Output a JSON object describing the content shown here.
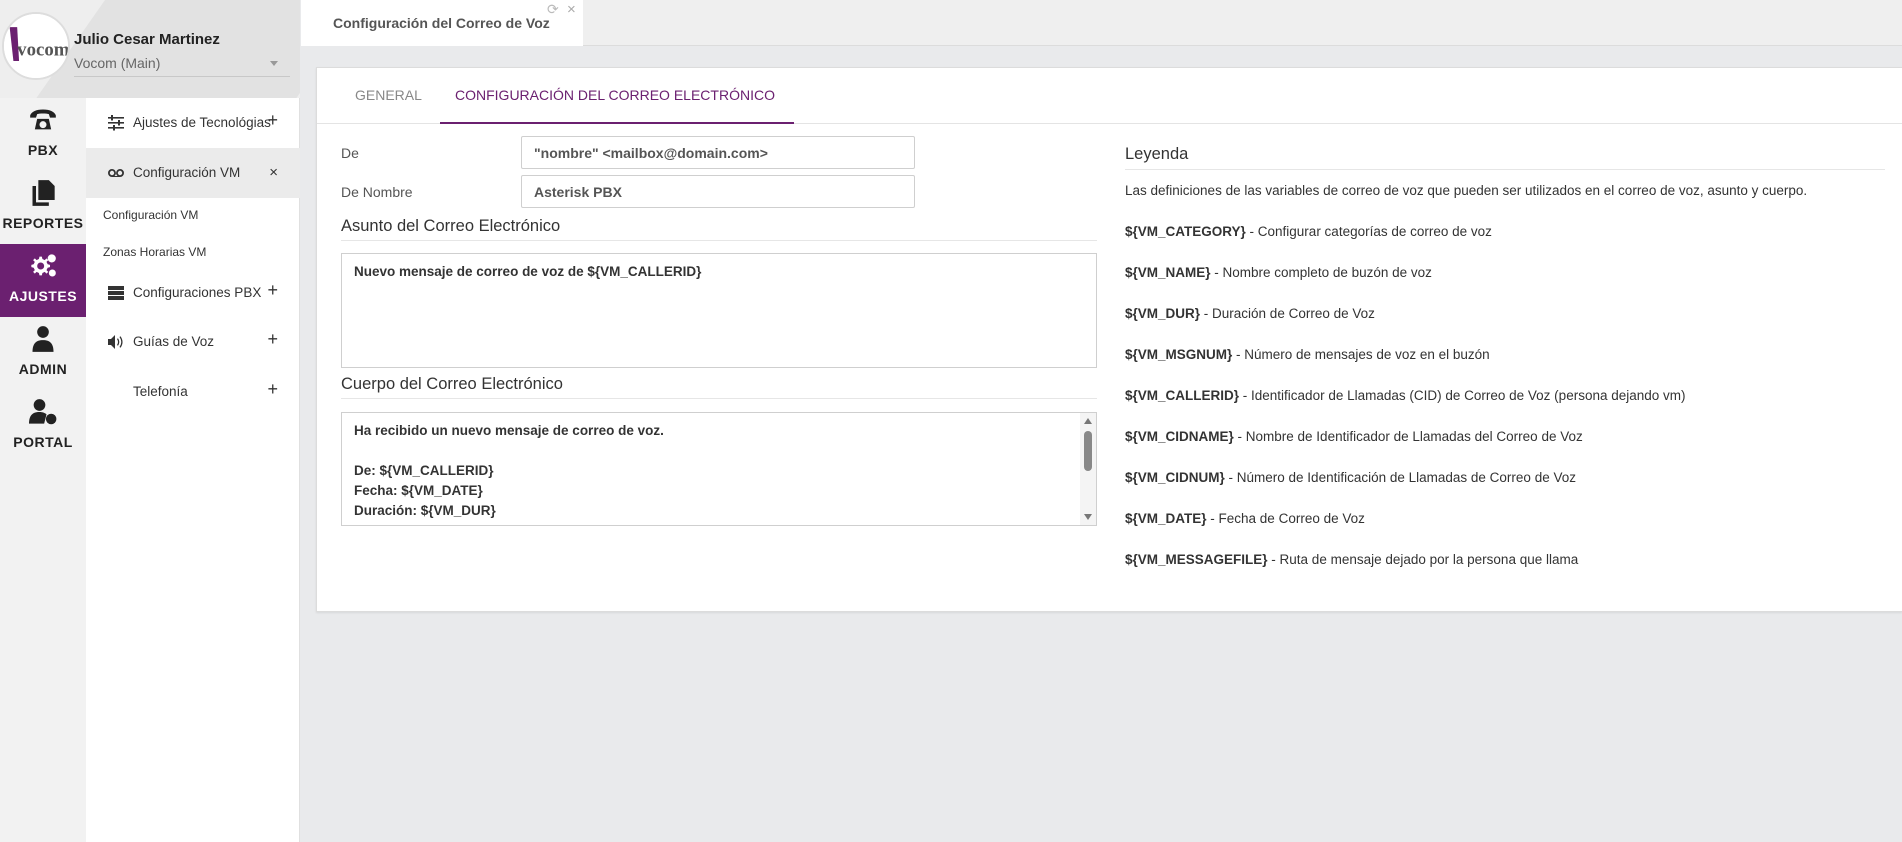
{
  "user": {
    "name": "Julio Cesar Martinez",
    "company": "Vocom (Main)",
    "logo_text": "vocom"
  },
  "rail": {
    "items": [
      {
        "label": "PBX",
        "icon": "phone-icon"
      },
      {
        "label": "REPORTES",
        "icon": "documents-icon"
      },
      {
        "label": "AJUSTES",
        "icon": "gears-icon",
        "active": true
      },
      {
        "label": "ADMIN",
        "icon": "admin-user-icon"
      },
      {
        "label": "PORTAL",
        "icon": "user-gear-icon"
      }
    ]
  },
  "menu": {
    "items": [
      {
        "label": "Ajustes de Tecnológias",
        "icon": "sliders-icon",
        "action": "+"
      },
      {
        "label": "Configuración VM",
        "icon": "voicemail-icon",
        "action": "×"
      },
      {
        "label": "Configuraciones PBX",
        "icon": "server-icon",
        "action": "+"
      },
      {
        "label": "Guías de Voz",
        "icon": "speaker-icon",
        "action": "+"
      },
      {
        "label": "Telefonía",
        "icon": "",
        "action": "+"
      }
    ],
    "subitems": [
      "Configuración VM",
      "Zonas Horarias VM"
    ]
  },
  "page_tab": {
    "label": "Configuración del Correo de Voz"
  },
  "card_tabs": {
    "general": "GENERAL",
    "email": "CONFIGURACIÓN DEL CORREO ELECTRÓNICO"
  },
  "form": {
    "from_label": "De",
    "from_value": "\"nombre\" <mailbox@domain.com>",
    "from_name_label": "De Nombre",
    "from_name_value": "Asterisk PBX",
    "subject_title": "Asunto del Correo Electrónico",
    "subject_value": "Nuevo mensaje de correo de voz de ${VM_CALLERID}",
    "body_title": "Cuerpo del Correo Electrónico",
    "body_lines": [
      "Ha recibido un nuevo mensaje de correo de voz.",
      "",
      "De: ${VM_CALLERID}",
      "Fecha: ${VM_DATE}",
      "Duración: ${VM_DUR}"
    ]
  },
  "legend": {
    "title": "Leyenda",
    "description": "Las definiciones de las variables de correo de voz que pueden ser utilizados en el correo de voz, asunto y cuerpo.",
    "rows": [
      {
        "var": "${VM_CATEGORY}",
        "desc": " - Configurar categorías de correo de voz"
      },
      {
        "var": "${VM_NAME}",
        "desc": " - Nombre completo de buzón de voz"
      },
      {
        "var": "${VM_DUR}",
        "desc": " - Duración de Correo de Voz"
      },
      {
        "var": "${VM_MSGNUM}",
        "desc": " - Número de mensajes de voz en el buzón"
      },
      {
        "var": "${VM_CALLERID}",
        "desc": " - Identificador de Llamadas (CID) de Correo de Voz (persona dejando vm)"
      },
      {
        "var": "${VM_CIDNAME}",
        "desc": " - Nombre de Identificador de Llamadas del Correo de Voz"
      },
      {
        "var": "${VM_CIDNUM}",
        "desc": " - Número de Identificación de Llamadas de Correo de Voz"
      },
      {
        "var": "${VM_DATE}",
        "desc": " - Fecha de Correo de Voz"
      },
      {
        "var": "${VM_MESSAGEFILE}",
        "desc": " - Ruta de mensaje dejado por la persona que llama"
      }
    ]
  },
  "colors": {
    "accent": "#6b2070",
    "background": "#e9eaec"
  }
}
